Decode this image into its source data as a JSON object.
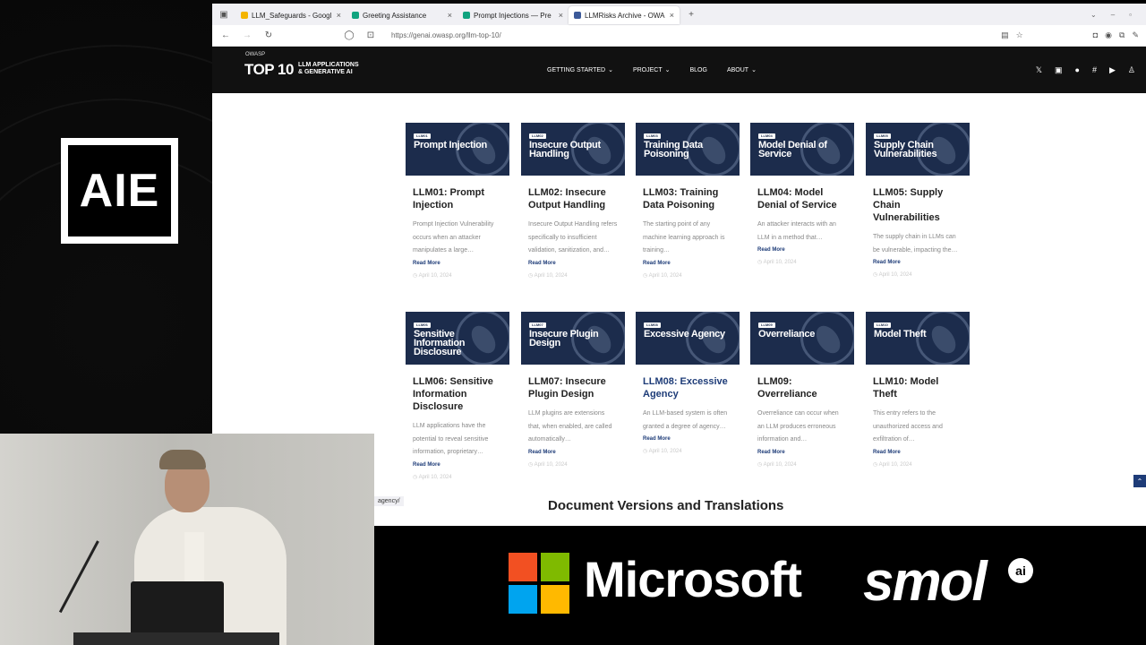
{
  "event_logo": {
    "text": "AIE"
  },
  "browser": {
    "tabs": [
      {
        "label": "LLM_Safeguards - Googl",
        "fav_color": "#f4b400",
        "active": false
      },
      {
        "label": "Greeting Assistance",
        "fav_color": "#10a37f",
        "active": false
      },
      {
        "label": "Prompt Injections — Pre",
        "fav_color": "#10a37f",
        "active": false
      },
      {
        "label": "LLMRisks Archive - OWA",
        "fav_color": "#3c5a99",
        "active": true
      }
    ],
    "url": "https://genai.owasp.org/llm-top-10/"
  },
  "site": {
    "logo_owasp": "OWASP",
    "logo_top10": "TOP 10",
    "logo_sub1": "LLM APPLICATIONS",
    "logo_sub2": "& GENERATIVE AI",
    "menu": [
      "GETTING STARTED",
      "PROJECT",
      "BLOG",
      "ABOUT"
    ]
  },
  "cards": [
    {
      "tag": "LLM01",
      "thumb": "Prompt Injection",
      "title": "LLM01: Prompt Injection",
      "desc": "Prompt Injection Vulnerability occurs when an attacker manipulates a large…",
      "more": "Read More",
      "date": "April 10, 2024"
    },
    {
      "tag": "LLM02",
      "thumb": "Insecure Output Handling",
      "title": "LLM02: Insecure Output Handling",
      "desc": "Insecure Output Handling refers specifically to insufficient validation, sanitization, and…",
      "more": "Read More",
      "date": "April 10, 2024"
    },
    {
      "tag": "LLM03",
      "thumb": "Training Data Poisoning",
      "title": "LLM03: Training Data Poisoning",
      "desc": "The starting point of any machine learning approach is training…",
      "more": "Read More",
      "date": "April 10, 2024"
    },
    {
      "tag": "LLM04",
      "thumb": "Model Denial of Service",
      "title": "LLM04: Model Denial of Service",
      "desc": "An attacker interacts with an LLM in a method that…",
      "more": "Read More",
      "date": "April 10, 2024"
    },
    {
      "tag": "LLM05",
      "thumb": "Supply Chain Vulnerabilities",
      "title": "LLM05: Supply Chain Vulnerabilities",
      "desc": "The supply chain in LLMs can be vulnerable, impacting the…",
      "more": "Read More",
      "date": "April 10, 2024"
    },
    {
      "tag": "LLM06",
      "thumb": "Sensitive Information Disclosure",
      "title": "LLM06: Sensitive Information Disclosure",
      "desc": "LLM applications have the potential to reveal sensitive information, proprietary…",
      "more": "Read More",
      "date": "April 10, 2024"
    },
    {
      "tag": "LLM07",
      "thumb": "Insecure Plugin Design",
      "title": "LLM07: Insecure Plugin Design",
      "desc": "LLM plugins are extensions that, when enabled, are called automatically…",
      "more": "Read More",
      "date": "April 10, 2024"
    },
    {
      "tag": "LLM08",
      "thumb": "Excessive Agency",
      "title": "LLM08: Excessive Agency",
      "desc": "An LLM-based system is often granted a degree of agency…",
      "more": "Read More",
      "date": "April 10, 2024"
    },
    {
      "tag": "LLM09",
      "thumb": "Overreliance",
      "title": "LLM09: Overreliance",
      "desc": "Overreliance can occur when an LLM produces erroneous information and…",
      "more": "Read More",
      "date": "April 10, 2024"
    },
    {
      "tag": "LLM10",
      "thumb": "Model Theft",
      "title": "LLM10: Model Theft",
      "desc": "This entry refers to the unauthorized access and exfiltration of…",
      "more": "Read More",
      "date": "April 10, 2024"
    }
  ],
  "doc_heading": "Document Versions and Translations",
  "status_url": "agency/",
  "sponsors": {
    "microsoft": "Microsoft",
    "smol": "smol",
    "smol_ai": "ai"
  }
}
